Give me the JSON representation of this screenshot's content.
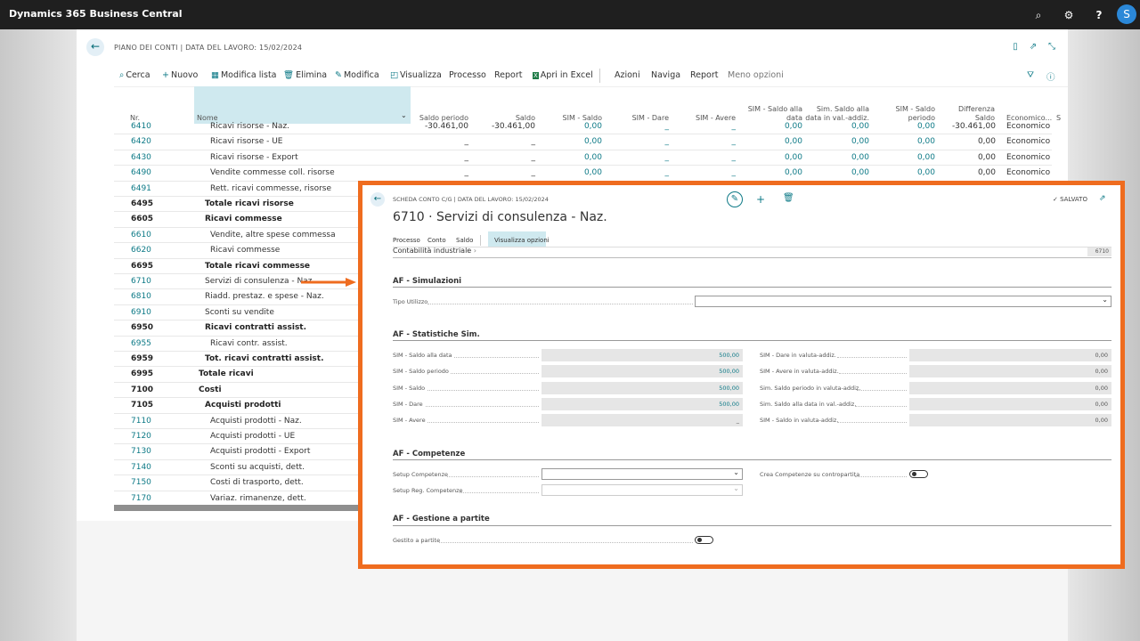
{
  "app": {
    "title": "Dynamics 365 Business Central",
    "avatar": "S"
  },
  "topbar_icons": [
    "search-icon",
    "settings-icon",
    "help-icon"
  ],
  "page": {
    "header": "PIANO DEI CONTI | DATA DEL LAVORO: 15/02/2024",
    "actions": [
      {
        "label": "Cerca",
        "icon": "⌕"
      },
      {
        "label": "Nuovo",
        "icon": "+"
      },
      {
        "label": "Modifica lista",
        "icon": "▦"
      },
      {
        "label": "Elimina",
        "icon": "🗑"
      },
      {
        "label": "Modifica",
        "icon": "✎"
      },
      {
        "label": "Visualizza",
        "icon": "◰"
      },
      {
        "label": "Processo",
        "icon": ""
      },
      {
        "label": "Report",
        "icon": ""
      },
      {
        "label": "Apri in Excel",
        "icon": "X"
      },
      {
        "label": "Azioni",
        "icon": ""
      },
      {
        "label": "Naviga",
        "icon": ""
      },
      {
        "label": "Report",
        "icon": ""
      },
      {
        "label": "Meno opzioni",
        "icon": ""
      }
    ],
    "columns": {
      "nr": "Nr.",
      "nome": "Nome",
      "saldo_periodo": "Saldo periodo",
      "saldo": "Saldo",
      "sim_saldo": "SIM - Saldo",
      "sim_dare": "SIM - Dare",
      "sim_avere": "SIM - Avere",
      "sim_saldo_data_1": "SIM - Saldo alla",
      "sim_saldo_data_2": "data",
      "sim_saldo_val_1": "Sim. Saldo alla",
      "sim_saldo_val_2": "data in val.-addiz.",
      "sim_saldo_periodo_1": "SIM - Saldo",
      "sim_saldo_periodo_2": "periodo",
      "differenza_1": "Differenza",
      "differenza_2": "Saldo",
      "economico": "Economico...",
      "s": "S"
    },
    "rows": [
      {
        "nr": "6410",
        "name": "Ricavi risorse - Naz.",
        "bold": false,
        "indent": 2,
        "saldo_periodo": "-30.461,00",
        "saldo": "-30.461,00",
        "sim_saldo": "0,00",
        "sim_dare": "_",
        "sim_avere": "_",
        "sim_data": "0,00",
        "sim_val": "0,00",
        "sim_per": "0,00",
        "diff": "-30.461,00",
        "eco": "Economico"
      },
      {
        "nr": "6420",
        "name": "Ricavi risorse - UE",
        "bold": false,
        "indent": 2,
        "saldo_periodo": "_",
        "saldo": "_",
        "sim_saldo": "0,00",
        "sim_dare": "_",
        "sim_avere": "_",
        "sim_data": "0,00",
        "sim_val": "0,00",
        "sim_per": "0,00",
        "diff": "0,00",
        "eco": "Economico"
      },
      {
        "nr": "6430",
        "name": "Ricavi risorse - Export",
        "bold": false,
        "indent": 2,
        "saldo_periodo": "_",
        "saldo": "_",
        "sim_saldo": "0,00",
        "sim_dare": "_",
        "sim_avere": "_",
        "sim_data": "0,00",
        "sim_val": "0,00",
        "sim_per": "0,00",
        "diff": "0,00",
        "eco": "Economico"
      },
      {
        "nr": "6490",
        "name": "Vendite commesse coll. risorse",
        "bold": false,
        "indent": 2,
        "saldo_periodo": "_",
        "saldo": "_",
        "sim_saldo": "0,00",
        "sim_dare": "_",
        "sim_avere": "_",
        "sim_data": "0,00",
        "sim_val": "0,00",
        "sim_per": "0,00",
        "diff": "0,00",
        "eco": "Economico"
      },
      {
        "nr": "6491",
        "name": "Rett. ricavi commesse, risorse",
        "bold": false,
        "indent": 2
      },
      {
        "nr": "6495",
        "name": "Totale ricavi risorse",
        "bold": true,
        "indent": 1
      },
      {
        "nr": "6605",
        "name": "Ricavi commesse",
        "bold": true,
        "indent": 1
      },
      {
        "nr": "6610",
        "name": "Vendite, altre spese commessa",
        "bold": false,
        "indent": 2
      },
      {
        "nr": "6620",
        "name": "Ricavi commesse",
        "bold": false,
        "indent": 2
      },
      {
        "nr": "6695",
        "name": "Totale ricavi commesse",
        "bold": true,
        "indent": 1
      },
      {
        "nr": "6710",
        "name": "Servizi di consulenza - Naz.",
        "bold": false,
        "indent": 1
      },
      {
        "nr": "6810",
        "name": "Riadd. prestaz. e spese - Naz.",
        "bold": false,
        "indent": 1
      },
      {
        "nr": "6910",
        "name": "Sconti su vendite",
        "bold": false,
        "indent": 1
      },
      {
        "nr": "6950",
        "name": "Ricavi contratti assist.",
        "bold": true,
        "indent": 1
      },
      {
        "nr": "6955",
        "name": "Ricavi contr. assist.",
        "bold": false,
        "indent": 2
      },
      {
        "nr": "6959",
        "name": "Tot. ricavi contratti assist.",
        "bold": true,
        "indent": 1
      },
      {
        "nr": "6995",
        "name": "Totale ricavi",
        "bold": true,
        "indent": 0
      },
      {
        "nr": "7100",
        "name": "Costi",
        "bold": true,
        "indent": 0
      },
      {
        "nr": "7105",
        "name": "Acquisti prodotti",
        "bold": true,
        "indent": 1
      },
      {
        "nr": "7110",
        "name": "Acquisti prodotti - Naz.",
        "bold": false,
        "indent": 2
      },
      {
        "nr": "7120",
        "name": "Acquisti prodotti - UE",
        "bold": false,
        "indent": 2
      },
      {
        "nr": "7130",
        "name": "Acquisti prodotti - Export",
        "bold": false,
        "indent": 2
      },
      {
        "nr": "7140",
        "name": "Sconti su acquisti, dett.",
        "bold": false,
        "indent": 2
      },
      {
        "nr": "7150",
        "name": "Costi di trasporto, dett.",
        "bold": false,
        "indent": 2
      },
      {
        "nr": "7170",
        "name": "Variaz. rimanenze, dett.",
        "bold": false,
        "indent": 2
      }
    ]
  },
  "card": {
    "header": "SCHEDA CONTO C/G | DATA DEL LAVORO: 15/02/2024",
    "title": "6710 · Servizi di consulenza - Naz.",
    "saved": "✓ SALVATO",
    "tabs": [
      "Processo",
      "Conto",
      "Saldo",
      "Visualizza opzioni"
    ],
    "contabilita": "Contabilità industriale",
    "contabilita_value": "6710",
    "sections": {
      "simulazioni": {
        "title": "AF - Simulazioni",
        "tipo_utilizzo_label": "Tipo Utilizzo",
        "tipo_utilizzo_value": ""
      },
      "statistiche": {
        "title": "AF - Statistiche Sim.",
        "left": [
          {
            "label": "SIM - Saldo alla data",
            "value": "500,00"
          },
          {
            "label": "SIM - Saldo periodo",
            "value": "500,00"
          },
          {
            "label": "SIM - Saldo",
            "value": "500,00"
          },
          {
            "label": "SIM - Dare",
            "value": "500,00"
          },
          {
            "label": "SIM - Avere",
            "value": "_"
          }
        ],
        "right": [
          {
            "label": "SIM - Dare in valuta-addiz.",
            "value": "0,00"
          },
          {
            "label": "SIM - Avere in valuta-addiz.",
            "value": "0,00"
          },
          {
            "label": "Sim. Saldo periodo in valuta-addiz.",
            "value": "0,00"
          },
          {
            "label": "Sim. Saldo alla data in val.-addiz.",
            "value": "0,00"
          },
          {
            "label": "SIM - Saldo in valuta-addiz.",
            "value": "0,00"
          }
        ]
      },
      "competenze": {
        "title": "AF - Competenze",
        "setup_label": "Setup Competenze",
        "setup_reg_label": "Setup Reg. Competenze",
        "crea_label": "Crea Competenze su contropartita",
        "crea_on": false
      },
      "partite": {
        "title": "AF - Gestione a partite",
        "gestito_label": "Gestito a partite",
        "gestito_on": false
      }
    }
  },
  "colors": {
    "accent": "#0e7a87",
    "highlight": "#ef6c1f",
    "topbar": "#1f1f1f"
  }
}
